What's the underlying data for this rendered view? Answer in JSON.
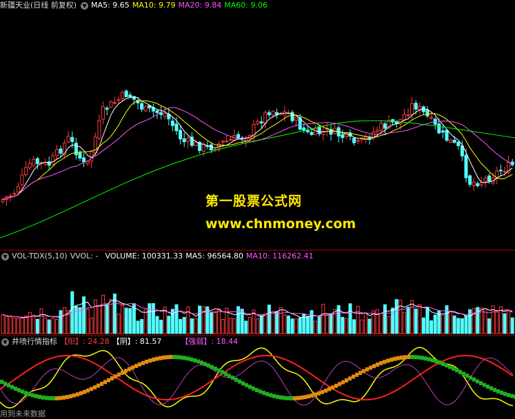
{
  "price_header": {
    "stock": "新疆天业(日线 前复权)",
    "ma5_label": "MA5: 9.65",
    "ma10_label": "MA10: 9.79",
    "ma20_label": "MA20: 9.84",
    "ma60_label": "MA60: 9.06"
  },
  "vol_header": {
    "name": "VOL-TDX(5,10)",
    "vvol": "VVOL: -",
    "volume": "VOLUME: 100331.33",
    "ma5": "MA5: 96564.80",
    "ma10": "MA10: 116262.41"
  },
  "ind_header": {
    "name": "井喷行情指标",
    "yang": "【阳】: 24.28",
    "yin": "【阴】: 81.57",
    "qr": "【强弱】: 18.44"
  },
  "watermark": {
    "line1": "第一股票公式网",
    "line2": "www.chnmoney.com"
  },
  "footer": "用到未来数据",
  "colors": {
    "up": "#ff3b3b",
    "down": "#54ffff",
    "ma5": "#ffffff",
    "ma10": "#ffff00",
    "ma20": "#ff55ff",
    "ma60": "#00ff00",
    "separator": "#b00000",
    "watermark": "#ffea00"
  }
}
